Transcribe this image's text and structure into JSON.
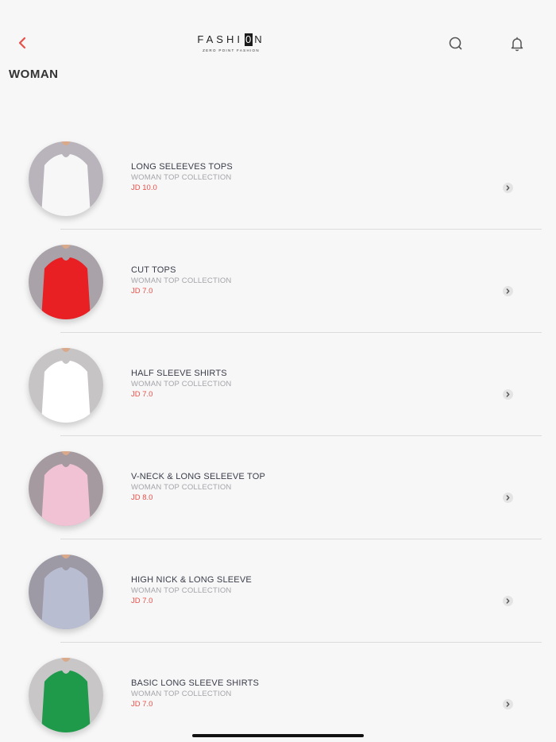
{
  "header": {
    "logo_left": "FASHI",
    "logo_box": "0",
    "logo_right": "N",
    "logo_tagline": "ZERO POINT FASHION"
  },
  "page": {
    "title": "WOMAN"
  },
  "colors": {
    "accent": "#e8504a",
    "text": "#3a3d4a",
    "muted": "#a4a4aa"
  },
  "products": [
    {
      "name": "LONG SELEEVES TOPS",
      "collection": "WOMAN TOP COLLECTION",
      "price": "JD 10.0",
      "garment": "#f7f7f7",
      "backdrop": "#b9b4bb"
    },
    {
      "name": "CUT TOPS",
      "collection": "WOMAN TOP COLLECTION",
      "price": "JD 7.0",
      "garment": "#e81f23",
      "backdrop": "#a9a2a8"
    },
    {
      "name": "HALF SLEEVE SHIRTS",
      "collection": "WOMAN TOP COLLECTION",
      "price": "JD 7.0",
      "garment": "#ffffff",
      "backdrop": "#c7c4c5"
    },
    {
      "name": "V-NECK & LONG SELEEVE TOP",
      "collection": "WOMAN TOP COLLECTION",
      "price": "JD 8.0",
      "garment": "#f1c2d3",
      "backdrop": "#a59aa0"
    },
    {
      "name": "HIGH NICK & LONG SLEEVE",
      "collection": "WOMAN TOP COLLECTION",
      "price": "JD 7.0",
      "garment": "#b9bdd2",
      "backdrop": "#9d9aa6"
    },
    {
      "name": "BASIC LONG SLEEVE SHIRTS",
      "collection": "WOMAN TOP COLLECTION",
      "price": "JD 7.0",
      "garment": "#1e9a4a",
      "backdrop": "#c9c6c8"
    }
  ]
}
